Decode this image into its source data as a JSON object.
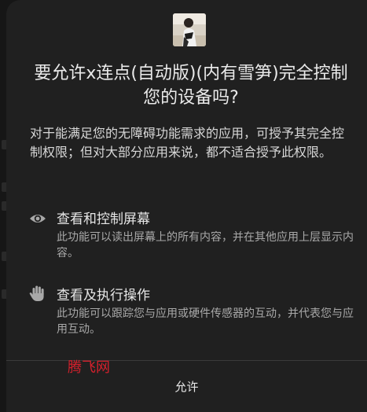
{
  "dialog": {
    "title": "要允许x连点(自动版)(内有雪笋)完全控制您的设备吗?",
    "description": "对于能满足您的无障碍功能需求的应用，可授予其完全控制权限；但对大部分应用来说，都不适合授予此权限。",
    "permissions": [
      {
        "icon": "eye-icon",
        "title": "查看和控制屏幕",
        "description": "此功能可以读出屏幕上的所有内容，并在其他应用上层显示内容。"
      },
      {
        "icon": "hand-icon",
        "title": "查看及执行操作",
        "description": "此功能可以跟踪您与应用或硬件传感器的互动，并代表您与应用互动。"
      }
    ],
    "allow_label": "允许"
  },
  "watermark": "腾飞网",
  "colors": {
    "dialog_bg": "#202020",
    "text_primary": "#eaeaea",
    "text_secondary": "#a9a9a9",
    "watermark": "#d4202c"
  }
}
